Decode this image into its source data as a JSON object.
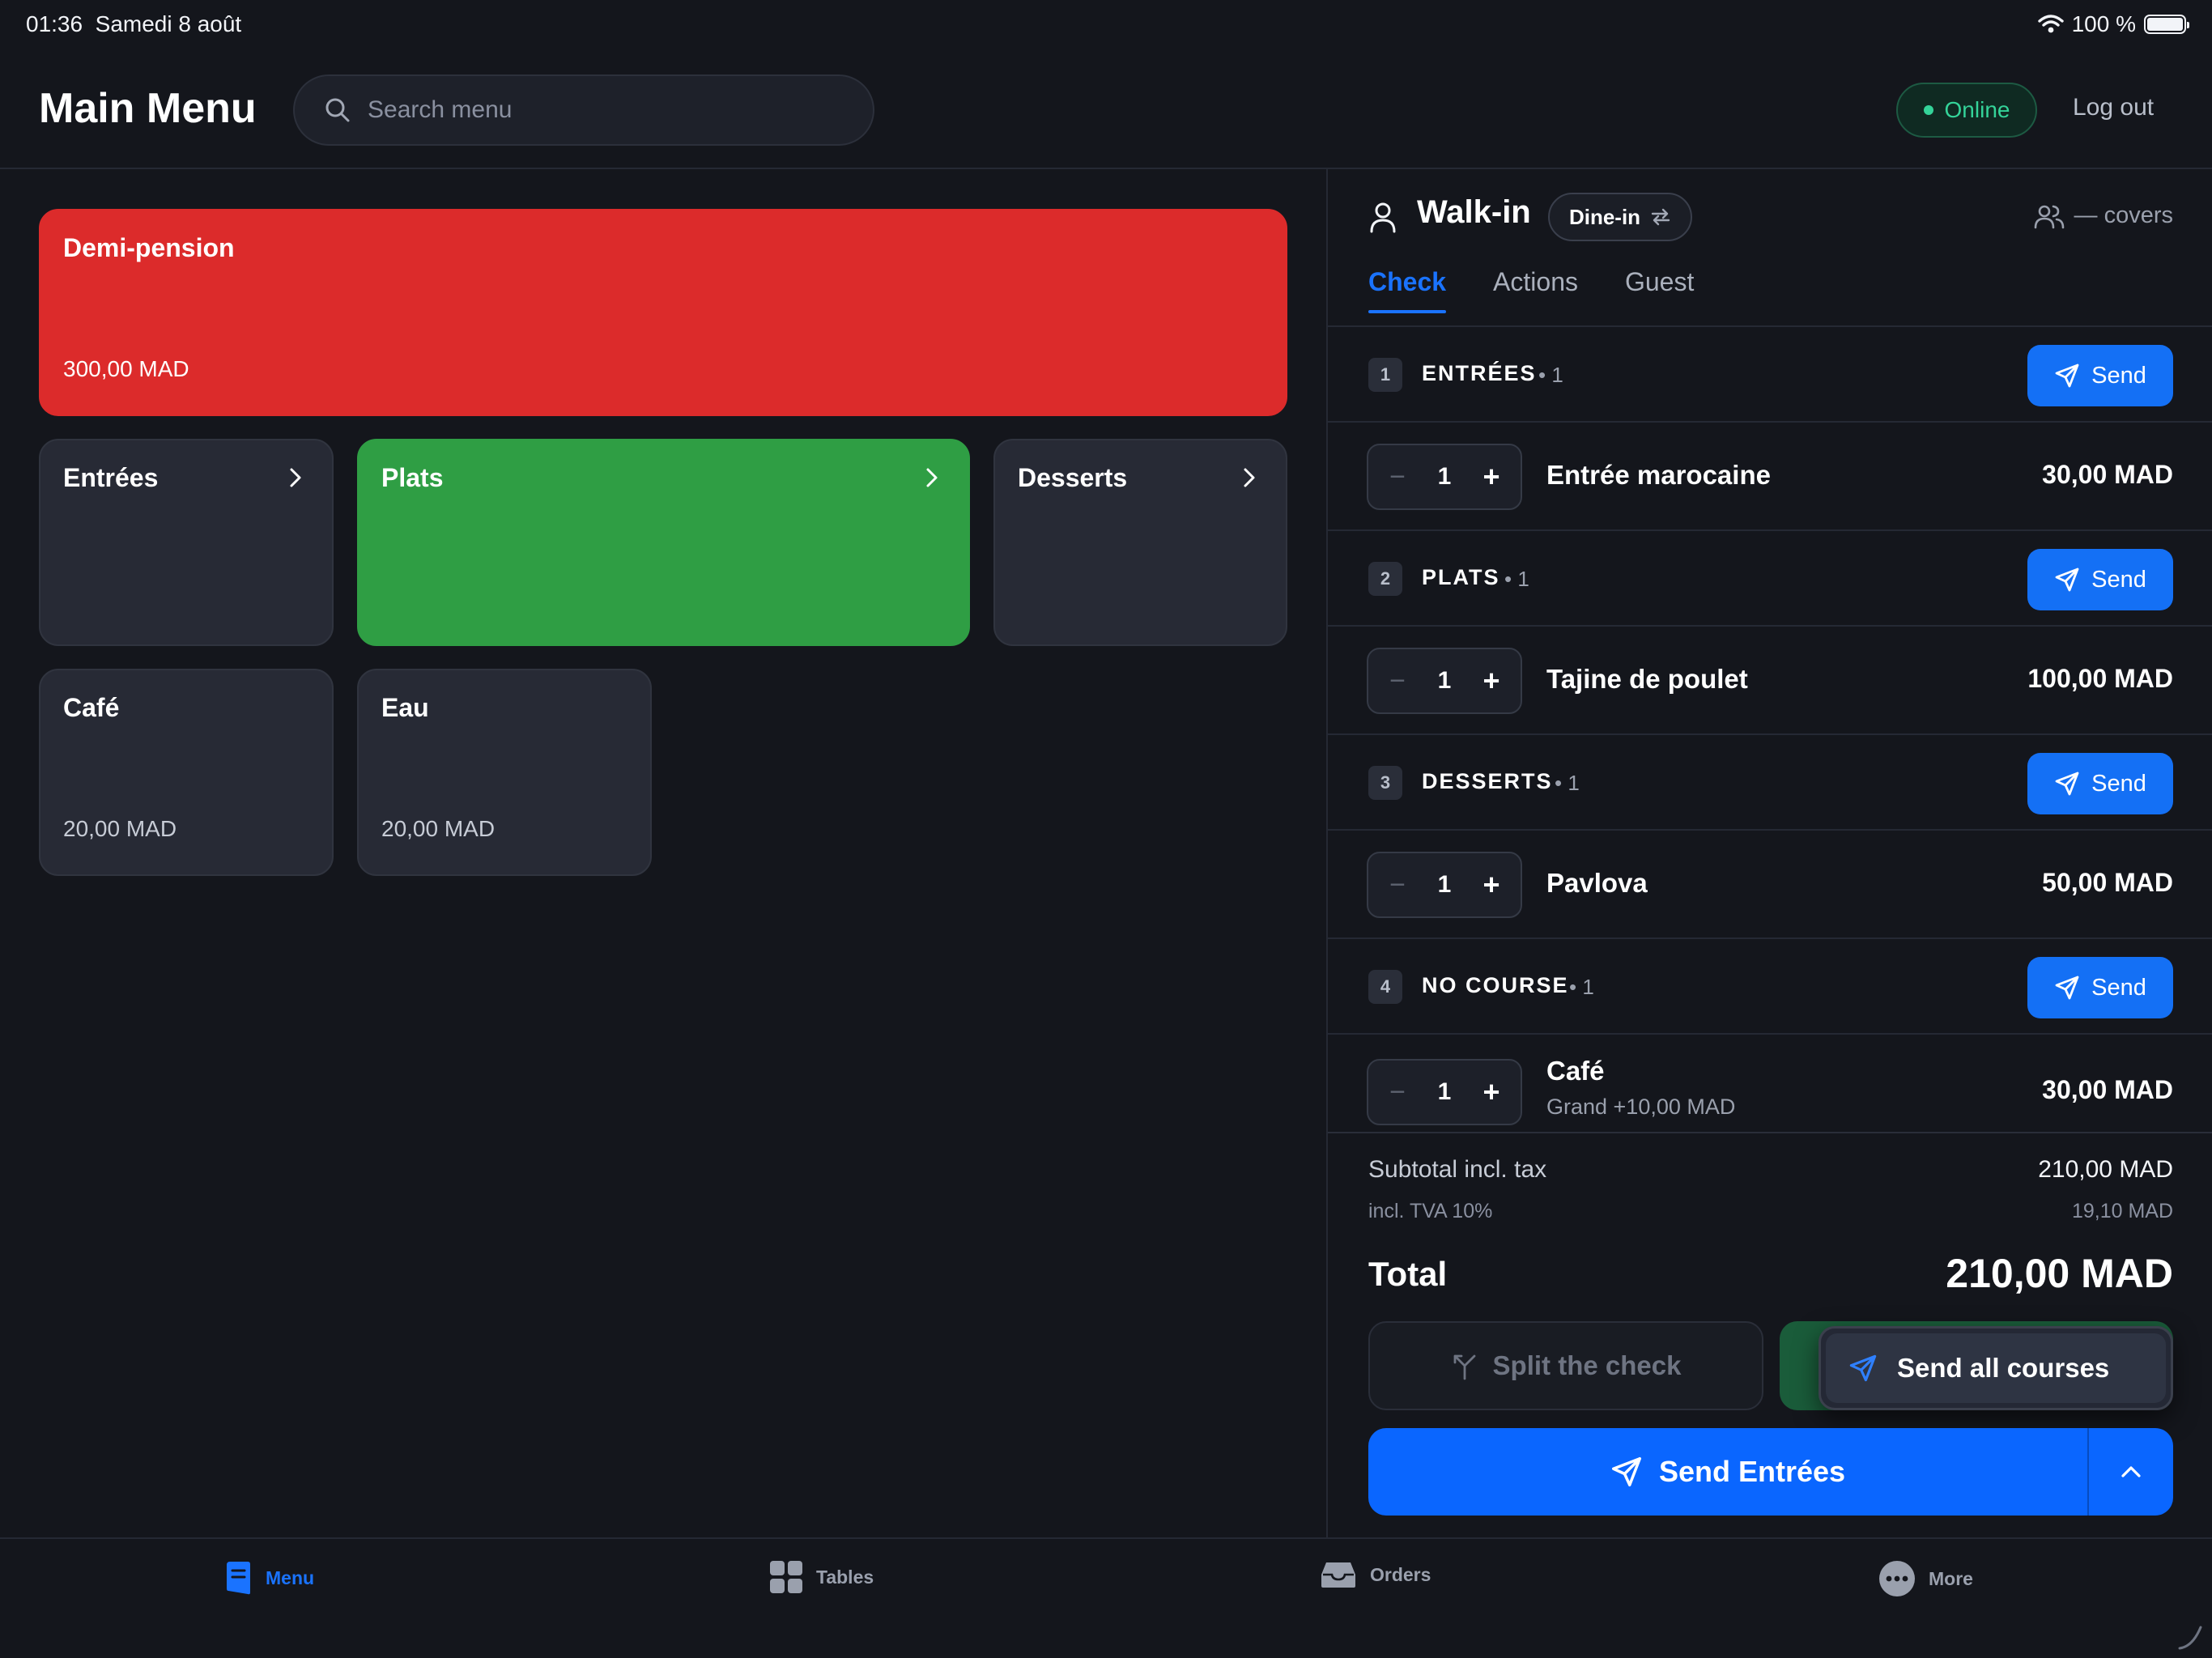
{
  "status_bar": {
    "time": "01:36",
    "date": "Samedi 8 août",
    "battery": "100 %"
  },
  "header": {
    "title": "Main Menu",
    "search_placeholder": "Search menu",
    "status": "Online",
    "logout": "Log out"
  },
  "menu": {
    "featured": {
      "name": "Demi-pension",
      "price": "300,00 MAD",
      "color": "#dc2b2b"
    },
    "categories": [
      {
        "name": "Entrées"
      },
      {
        "name": "Plats",
        "color": "#2f9e44"
      },
      {
        "name": "Desserts"
      }
    ],
    "items": [
      {
        "name": "Café",
        "price": "20,00 MAD"
      },
      {
        "name": "Eau",
        "price": "20,00 MAD"
      }
    ]
  },
  "check": {
    "customer": "Walk-in",
    "service_mode": "Dine-in",
    "covers": "— covers",
    "tabs": [
      "Check",
      "Actions",
      "Guest"
    ],
    "send_label": "Send",
    "courses": [
      {
        "number": "1",
        "title": "ENTRÉES",
        "count": "1",
        "items": [
          {
            "qty": "1",
            "name": "Entrée marocaine",
            "price": "30,00 MAD"
          }
        ]
      },
      {
        "number": "2",
        "title": "PLATS",
        "count": "1",
        "items": [
          {
            "qty": "1",
            "name": "Tajine de poulet",
            "price": "100,00 MAD"
          }
        ]
      },
      {
        "number": "3",
        "title": "DESSERTS",
        "count": "1",
        "items": [
          {
            "qty": "1",
            "name": "Pavlova",
            "price": "50,00 MAD"
          }
        ]
      },
      {
        "number": "4",
        "title": "NO COURSE",
        "count": "1",
        "items": [
          {
            "qty": "1",
            "name": "Café",
            "modifier": "Grand +10,00 MAD",
            "price": "30,00 MAD"
          }
        ]
      }
    ],
    "subtotal_label": "Subtotal incl. tax",
    "subtotal": "210,00 MAD",
    "tax_label": "incl. TVA 10%",
    "tax": "19,10 MAD",
    "total_label": "Total",
    "total": "210,00 MAD",
    "split_label": "Split the check",
    "send_all_label": "Send all courses",
    "send_main_label": "Send Entrées"
  },
  "bottom_nav": [
    {
      "label": "Menu",
      "icon": "menu-book-icon",
      "active": true
    },
    {
      "label": "Tables",
      "icon": "tables-grid-icon"
    },
    {
      "label": "Orders",
      "icon": "orders-tray-icon"
    },
    {
      "label": "More",
      "icon": "more-dots-icon"
    }
  ],
  "colors": {
    "accent": "#0a66ff",
    "online": "#34d399",
    "background": "#14161c"
  }
}
